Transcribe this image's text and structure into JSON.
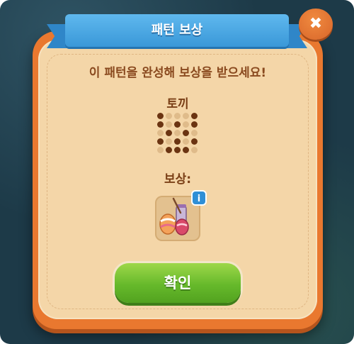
{
  "dialog": {
    "title": "패턴 보상",
    "message": "이 패턴을 완성해 보상을 받으세요!",
    "pattern_name": "토끼",
    "pattern_grid": [
      [
        1,
        0,
        0,
        0,
        1
      ],
      [
        1,
        0,
        1,
        0,
        1
      ],
      [
        0,
        1,
        0,
        1,
        0
      ],
      [
        1,
        0,
        1,
        0,
        1
      ],
      [
        0,
        1,
        1,
        1,
        0
      ]
    ],
    "reward_label": "보상:",
    "reward_item_icon": "easter-eggs-and-paint-jar-icon",
    "info_icon": "i",
    "close_icon": "✖",
    "confirm_label": "확인"
  },
  "colors": {
    "frame": "#e9782f",
    "panel": "#f4d6a8",
    "ribbon": "#3a98d8",
    "confirm": "#66b92b",
    "pattern_on": "#6b3412",
    "pattern_off": "#dfbb8a"
  }
}
